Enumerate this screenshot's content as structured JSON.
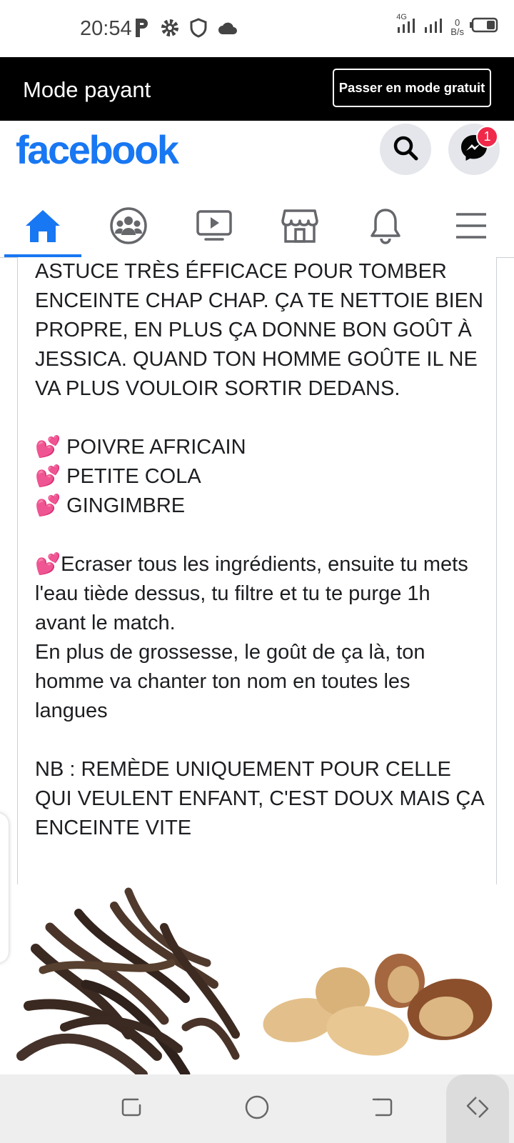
{
  "status_bar": {
    "time": "20:54",
    "network": "4G",
    "speed_value": "0",
    "speed_unit": "B/s"
  },
  "mode_banner": {
    "label": "Mode payant",
    "button_label": "Passer en mode gratuit"
  },
  "header": {
    "logo": "facebook",
    "messenger_badge": "1",
    "brand_color": "#1877f2"
  },
  "nav_tabs": [
    {
      "name": "home",
      "icon": "home-icon",
      "active": true
    },
    {
      "name": "groups",
      "icon": "groups-icon",
      "active": false
    },
    {
      "name": "watch",
      "icon": "video-icon",
      "active": false
    },
    {
      "name": "marketplace",
      "icon": "marketplace-icon",
      "active": false
    },
    {
      "name": "notifications",
      "icon": "bell-icon",
      "active": false
    },
    {
      "name": "menu",
      "icon": "menu-icon",
      "active": false
    }
  ],
  "post": {
    "intro": "ASTUCE TRÈS ÉFFICACE POUR TOMBER ENCEINTE CHAP CHAP. ÇA TE NETTOIE BIEN PROPRE, EN PLUS ÇA DONNE BON GOÛT À JESSICA. QUAND TON HOMME GOÛTE IL NE VA PLUS VOULOIR SORTIR DEDANS.",
    "ingredients": [
      "POIVRE AFRICAIN",
      "PETITE COLA",
      "GINGIMBRE"
    ],
    "heart_emoji": "💕",
    "instructions": "Ecraser tous les ingrédients, ensuite tu mets l'eau tiède dessus, tu filtre et tu te purge 1h avant le match.",
    "extra": "En plus de grossesse, le goût de ça là, ton homme va chanter ton nom en toutes les langues",
    "note": "NB : REMÈDE UNIQUEMENT POUR CELLE QUI VEULENT ENFANT, C'EST DOUX MAIS ÇA ENCEINTE VITE"
  },
  "android_nav": {
    "buttons": [
      "recents-icon",
      "home-circle-icon",
      "back-icon",
      "rotate-icon"
    ]
  }
}
